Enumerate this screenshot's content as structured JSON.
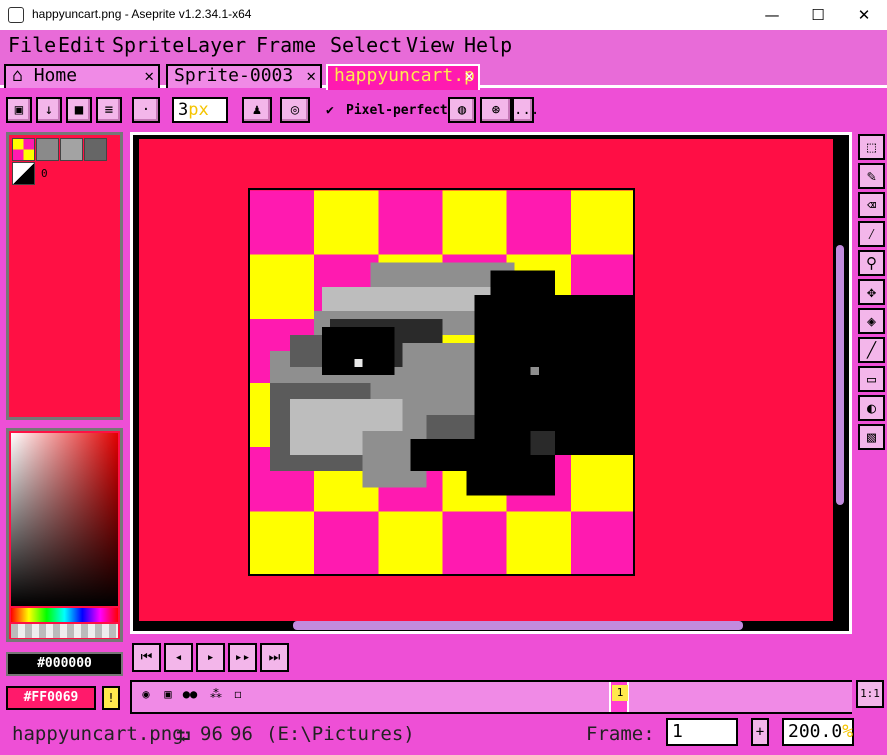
{
  "window": {
    "title": "happyuncart.png - Aseprite v1.2.34.1-x64",
    "minimize": "—",
    "maximize": "☐",
    "close": "✕"
  },
  "menu": [
    "File",
    "Edit",
    "Sprite",
    "Layer",
    "Frame",
    "Select",
    "View",
    "Help"
  ],
  "tabs": [
    {
      "label": "Home",
      "close": "✕"
    },
    {
      "label": "Sprite-0003",
      "close": "✕"
    },
    {
      "label": "happyuncart.p",
      "close": "✕"
    }
  ],
  "toolbar": {
    "zoom_value": "3",
    "zoom_suffix": "px",
    "pixel_perfect_label": "Pixel-perfect",
    "more_label": "..."
  },
  "palette": {
    "index_label": "0",
    "swatches": [
      "#ff0e8c",
      "#8a8a8a",
      "#a3a3a3",
      "#666666"
    ]
  },
  "colors": {
    "foreground_hex": "#000000",
    "background_hex": "#FF0069",
    "accent": "#ee4fd6",
    "canvas_bg": "#ff0e45"
  },
  "sprite": {
    "checker": [
      "#ff1ab0",
      "#ffff00"
    ],
    "grays": [
      "#e8e8e8",
      "#bdbdbd",
      "#8f8f8f",
      "#5b5b5b",
      "#2a2a2a",
      "#000000"
    ]
  },
  "timeline": {
    "frame_number": "1"
  },
  "status": {
    "filename": "happyuncart.png",
    "size_icon": "⮒",
    "width": "96",
    "height": "96",
    "path": "(E:\\Pictures)",
    "frame_label": "Frame:",
    "frame_value": "1",
    "zoom_value": "200.0",
    "zoom_suffix": "%"
  },
  "ratio_label": "1:1"
}
